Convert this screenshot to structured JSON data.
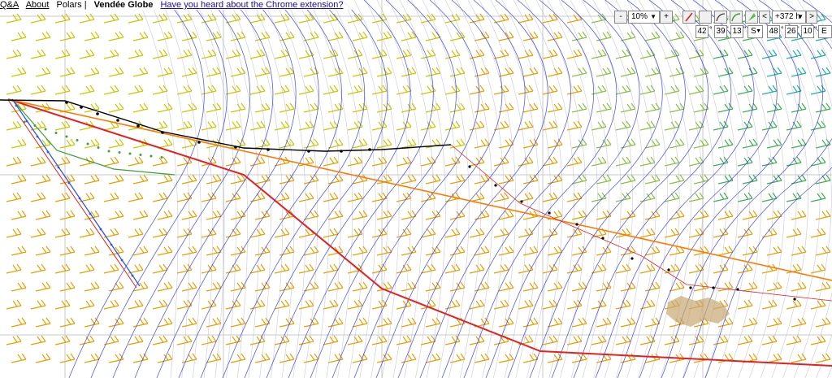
{
  "menu": {
    "qa": "Q&A",
    "about": "About",
    "polars": "Polars |",
    "race": "Vendée Globe",
    "extension_link": "Have you heard about the Chrome extension?"
  },
  "controls": {
    "zoom_out": "-",
    "zoom_value": "10%",
    "zoom_in": "+",
    "time_prev": "<",
    "time_value": "+372 h",
    "time_next": ">",
    "lat_deg": "42",
    "lat_min": "39",
    "lat_sec": "13",
    "lat_hemi": "S",
    "lon_deg": "48",
    "lon_min": "26",
    "lon_sec": "10",
    "lon_hemi": "E"
  },
  "colors": {
    "route_red": "#e52020",
    "route_orange": "#ff7a00",
    "route_green": "#3aa33a",
    "route_blue": "#3355dd",
    "isochrone_blue": "#1f2bd6",
    "isochrone_gray": "#b0b0c8",
    "wind_orange": "#e8a000",
    "wind_yellow": "#c8c800",
    "wind_green": "#3cb050",
    "land": "#c8a870"
  }
}
